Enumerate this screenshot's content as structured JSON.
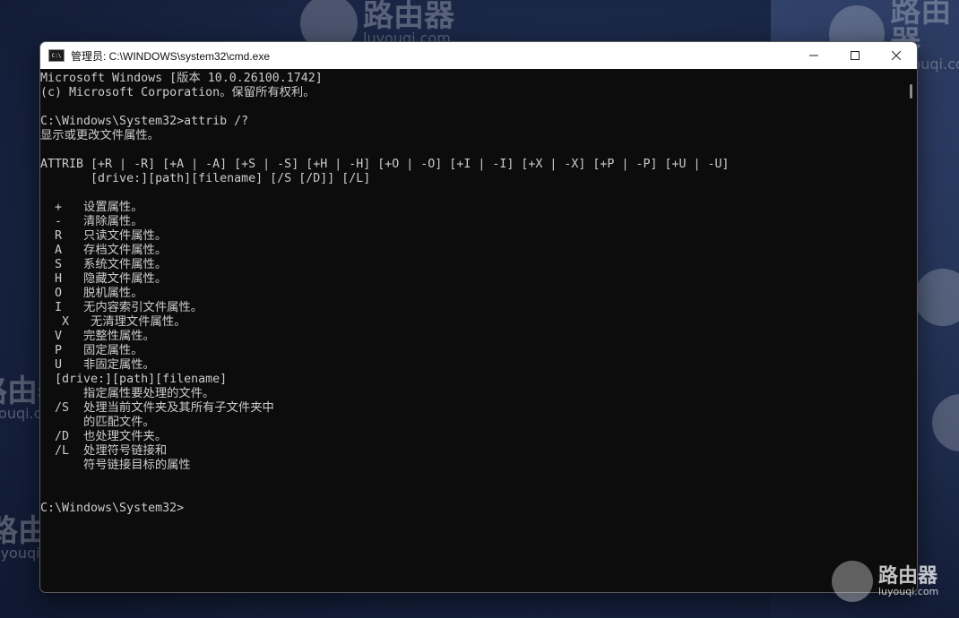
{
  "window": {
    "title": "管理员: C:\\WINDOWS\\system32\\cmd.exe",
    "icon_label": "C:\\"
  },
  "controls": {
    "minimize": "minimize-icon",
    "maximize": "maximize-icon",
    "close": "close-icon"
  },
  "watermark": {
    "brand": "路由器",
    "site": "luyouqi.com"
  },
  "console": {
    "lines": [
      "Microsoft Windows [版本 10.0.26100.1742]",
      "(c) Microsoft Corporation。保留所有权利。",
      "",
      "C:\\Windows\\System32>attrib /?",
      "显示或更改文件属性。",
      "",
      "ATTRIB [+R | -R] [+A | -A] [+S | -S] [+H | -H] [+O | -O] [+I | -I] [+X | -X] [+P | -P] [+U | -U]",
      "       [drive:][path][filename] [/S [/D]] [/L]",
      "",
      "  +   设置属性。",
      "  -   清除属性。",
      "  R   只读文件属性。",
      "  A   存档文件属性。",
      "  S   系统文件属性。",
      "  H   隐藏文件属性。",
      "  O   脱机属性。",
      "  I   无内容索引文件属性。",
      "   X   无清理文件属性。",
      "  V   完整性属性。",
      "  P   固定属性。",
      "  U   非固定属性。",
      "  [drive:][path][filename]",
      "      指定属性要处理的文件。",
      "  /S  处理当前文件夹及其所有子文件夹中",
      "      的匹配文件。",
      "  /D  也处理文件夹。",
      "  /L  处理符号链接和",
      "      符号链接目标的属性",
      "",
      "",
      "C:\\Windows\\System32>"
    ]
  }
}
